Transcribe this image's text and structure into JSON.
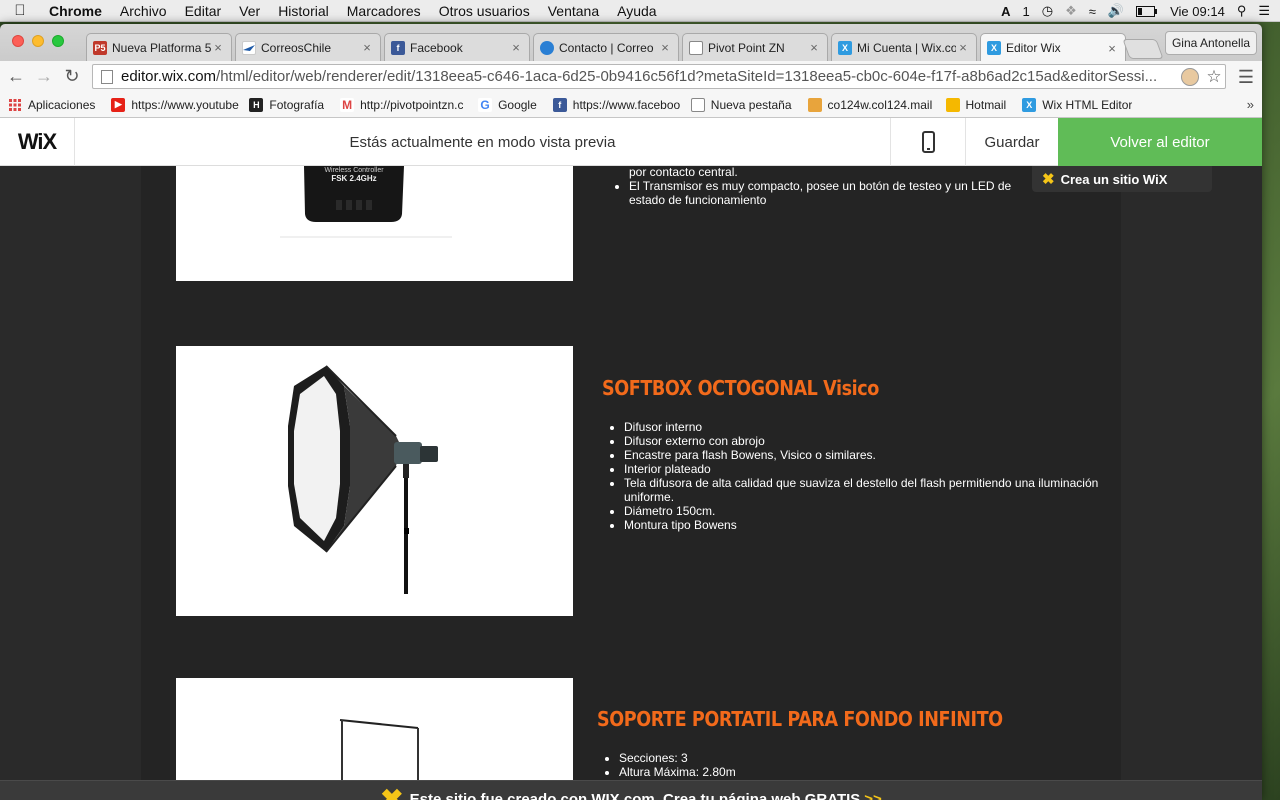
{
  "menubar": {
    "app": "Chrome",
    "items": [
      "Archivo",
      "Editar",
      "Ver",
      "Historial",
      "Marcadores",
      "Otros usuarios",
      "Ventana",
      "Ayuda"
    ],
    "status_num": "1",
    "clock": "Vie 09:14"
  },
  "browser": {
    "tabs": [
      {
        "label": "Nueva Platforma 5",
        "icon_color": "#c0392b",
        "icon_text": "P5"
      },
      {
        "label": "CorreosChile",
        "icon_color": "#1e5aa8",
        "icon_text": ""
      },
      {
        "label": "Facebook",
        "icon_color": "#3b5998",
        "icon_text": "f"
      },
      {
        "label": "Contacto | Correo",
        "icon_color": "#2a7fd4",
        "icon_text": ""
      },
      {
        "label": "Pivot Point ZN",
        "icon_color": "#ffffff",
        "icon_text": ""
      },
      {
        "label": "Mi Cuenta | Wix.co",
        "icon_color": "#2f9be0",
        "icon_text": "X"
      },
      {
        "label": "Editor Wix",
        "icon_color": "#2f9be0",
        "icon_text": "X"
      }
    ],
    "profile_name": "Gina Antonella",
    "url_domain": "editor.wix.com",
    "url_rest": "/html/editor/web/renderer/edit/1318eea5-c646-1aca-6d25-0b9416c56f1d?metaSiteId=1318eea5-cb0c-604e-f17f-a8b6ad2c15ad&editorSessi...",
    "bookmarks": [
      {
        "label": "Aplicaciones",
        "icon_color": "#d44"
      },
      {
        "label": "https://www.youtube",
        "icon_color": "#e62117"
      },
      {
        "label": "Fotografía",
        "icon_color": "#222"
      },
      {
        "label": "http://pivotpointzn.c",
        "icon_color": "#d44"
      },
      {
        "label": "Google",
        "icon_color": "#4285f4"
      },
      {
        "label": "https://www.faceboo",
        "icon_color": "#3b5998"
      },
      {
        "label": "Nueva pestaña",
        "icon_color": "#ffffff"
      },
      {
        "label": "co124w.col124.mail",
        "icon_color": "#e8a43c"
      },
      {
        "label": "Hotmail",
        "icon_color": "#f5b800"
      },
      {
        "label": "Wix HTML Editor",
        "icon_color": "#2f9be0"
      }
    ]
  },
  "wixbar": {
    "logo": "WiX",
    "preview_message": "Estás actualmente en modo vista previa",
    "save_label": "Guardar",
    "back_label": "Volver al editor"
  },
  "site": {
    "crea_badge": "Crea un sitio WiX",
    "product1": {
      "device_label": "Wireless Controller",
      "device_model": "FSK 2.4GHz",
      "bullets": [
        "por contacto central.",
        "El Transmisor es muy compacto, posee un botón de testeo y un LED de estado de funcionamiento"
      ]
    },
    "product2": {
      "title": "SOFTBOX OCTOGONAL Visico",
      "bullets": [
        "Difusor interno",
        "Difusor externo con abrojo",
        "Encastre para flash Bowens, Visico o similares.",
        "Interior plateado",
        "Tela difusora de alta calidad que suaviza el destello del flash permitiendo una iluminación uniforme.",
        "Diámetro 150cm.",
        "Montura tipo Bowens"
      ]
    },
    "product3": {
      "title": "SOPORTE PORTATIL PARA FONDO INFINITO",
      "bullets": [
        "Secciones: 3",
        "Altura Máxima: 2.80m"
      ]
    },
    "footer_text": "Este sitio fue creado con WIX.com. Crea tu página web GRATIS",
    "footer_arrows": ">>"
  }
}
